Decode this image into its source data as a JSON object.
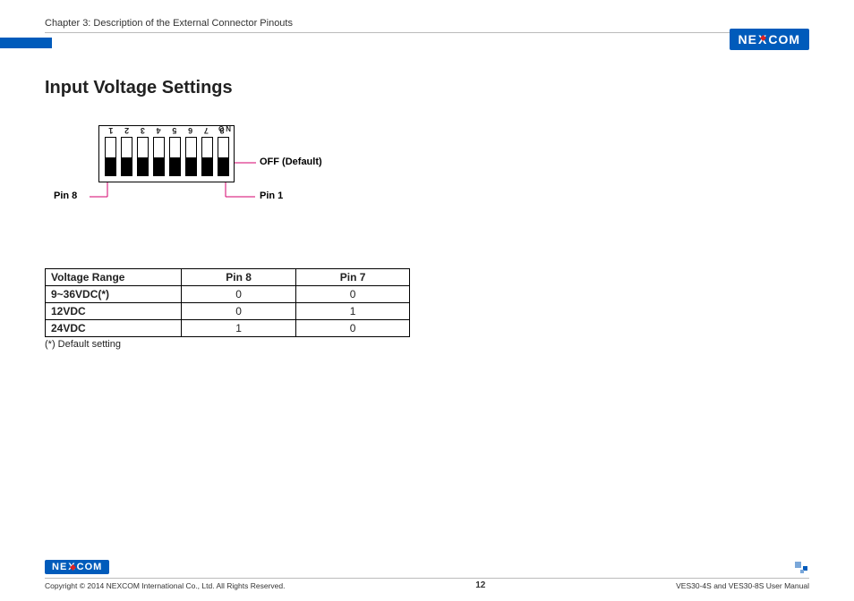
{
  "header": {
    "chapter": "Chapter 3: Description of the External Connector Pinouts",
    "brand_prefix": "NE",
    "brand_x": "X",
    "brand_suffix": "COM"
  },
  "title": "Input Voltage Settings",
  "dip": {
    "numbers": [
      "1",
      "2",
      "3",
      "4",
      "5",
      "6",
      "7",
      "8"
    ],
    "on_label": "NO",
    "off_label": "OFF (Default)",
    "pin8_label": "Pin 8",
    "pin1_label": "Pin 1"
  },
  "table": {
    "headers": [
      "Voltage Range",
      "Pin 8",
      "Pin 7"
    ],
    "rows": [
      [
        "9~36VDC(*)",
        "0",
        "0"
      ],
      [
        "12VDC",
        "0",
        "1"
      ],
      [
        "24VDC",
        "1",
        "0"
      ]
    ],
    "footnote": "(*) Default setting"
  },
  "footer": {
    "copyright": "Copyright © 2014 NEXCOM International Co., Ltd. All Rights Reserved.",
    "page": "12",
    "manual": "VES30-4S and VES30-8S User Manual"
  }
}
